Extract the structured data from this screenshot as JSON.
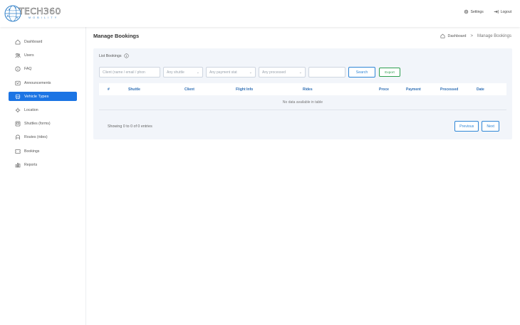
{
  "header": {
    "logo_text": "TECH360",
    "logo_subtext": "MOBILITY",
    "settings_label": "Settings",
    "logout_label": "Logout"
  },
  "sidebar": {
    "items": [
      {
        "label": "Dashboard",
        "icon": "home-icon"
      },
      {
        "label": "Users",
        "icon": "users-icon"
      },
      {
        "label": "FAQ",
        "icon": "info-icon"
      },
      {
        "label": "Announcements",
        "icon": "announcement-icon"
      },
      {
        "label": "Vehicle Types",
        "icon": "vehicle-icon",
        "active": true
      },
      {
        "label": "Location",
        "icon": "location-icon"
      },
      {
        "label": "Shuttles (forms)",
        "icon": "shuttle-icon"
      },
      {
        "label": "Routes (rides)",
        "icon": "routes-icon"
      },
      {
        "label": "Bookings",
        "icon": "bookings-icon"
      },
      {
        "label": "Reports",
        "icon": "reports-icon"
      }
    ]
  },
  "main": {
    "title": "Manage Bookings",
    "breadcrumb": {
      "home": "Dashboard",
      "separator": ">",
      "current": "Manage Bookings"
    },
    "panel_title": "List Bookings",
    "filters": {
      "client_placeholder": "Client (name / email / phon",
      "shuttle_select": "Any shuttle",
      "payment_select": "Any payment stat",
      "processed_select": "Any processed",
      "date_value": "",
      "search_label": "Search",
      "export_label": "Export"
    },
    "table": {
      "columns": [
        "#",
        "Shuttle",
        "Client",
        "Flight Info",
        "Rides",
        "Proce",
        "Payment",
        "Processed",
        "Date"
      ],
      "empty_text": "No data available in table"
    },
    "info_text": "Showing 0 to 0 of 0 entries",
    "pager": {
      "previous": "Previous",
      "next": "Next"
    }
  },
  "colors": {
    "accent": "#1b74e4",
    "link": "#2f86d6",
    "export": "#2e9e4f",
    "panel_bg": "#f2f5fa"
  }
}
